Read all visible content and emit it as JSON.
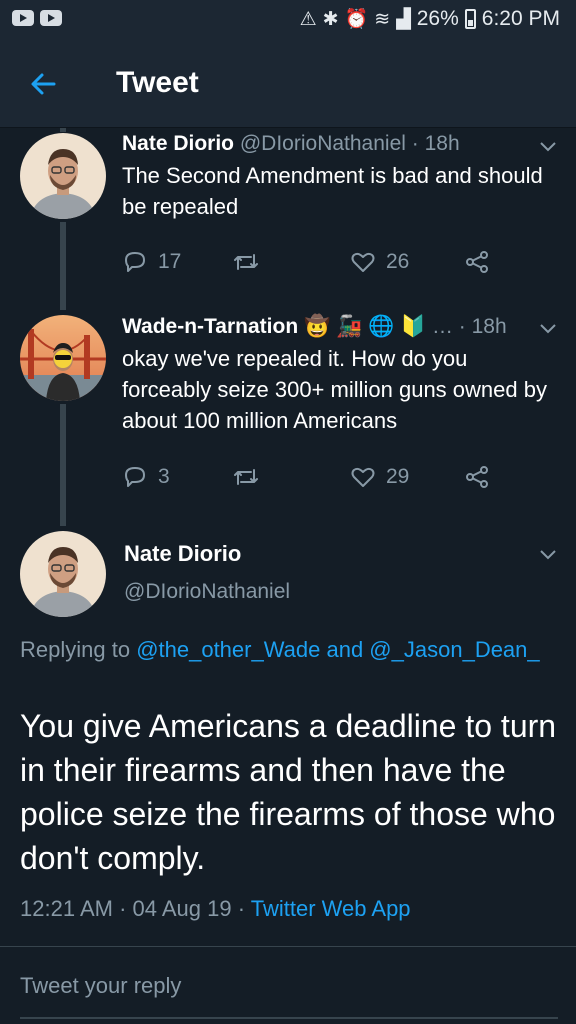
{
  "status_bar": {
    "battery": "26%",
    "time": "6:20 PM"
  },
  "app_bar": {
    "title": "Tweet"
  },
  "tweets": [
    {
      "name": "Nate Diorio",
      "handle": "@DIorioNathaniel",
      "time": "· 18h",
      "text": "The Second Amendment is bad and should be repealed",
      "replies": "17",
      "likes": "26"
    },
    {
      "name": "Wade-n-Tarnation",
      "emoji": "🤠 🚂 🌐 🔰",
      "ellipsis": "…",
      "handle": "",
      "time": "· 18h",
      "text": "okay we've repealed it. How do you forceably seize 300+ million guns owned by about 100 million Americans",
      "replies": "3",
      "likes": "29"
    }
  ],
  "main_tweet": {
    "name": "Nate Diorio",
    "handle": "@DIorioNathaniel",
    "replying_prefix": "Replying to ",
    "replying_users": "@the_other_Wade and @_Jason_Dean_",
    "text": "You give Americans a deadline to turn in their firearms and then have the police seize the firearms of those who don't comply.",
    "timestamp": "12:21 AM · 04 Aug 19 · ",
    "source": "Twitter Web App"
  },
  "reply_box": {
    "placeholder": "Tweet your reply"
  },
  "colors": {
    "background": "#141d26",
    "bar": "#1c2733",
    "accent": "#1da1f2",
    "muted": "#8899a6"
  }
}
